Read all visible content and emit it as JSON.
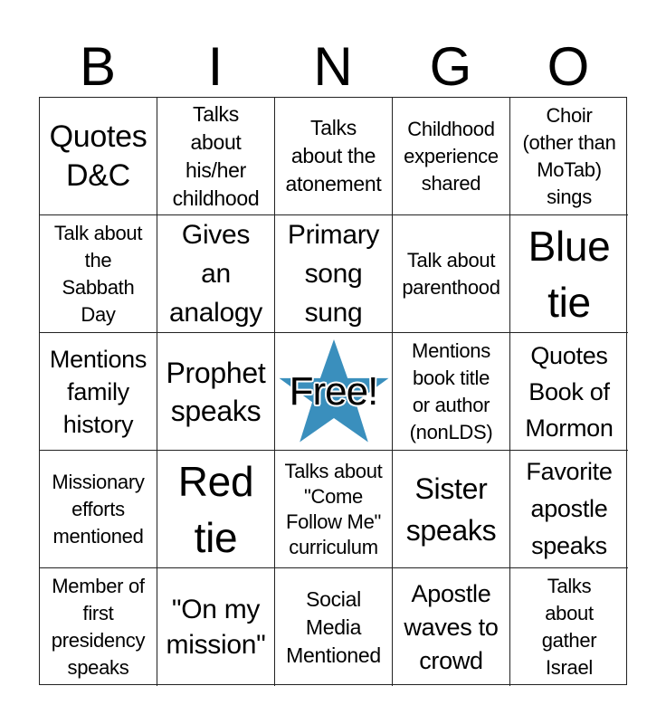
{
  "header": {
    "letters": [
      "B",
      "I",
      "N",
      "G",
      "O"
    ]
  },
  "colors": {
    "free_star": "#3a8fbd",
    "grid_line": "#222222"
  },
  "cells": [
    [
      "Quotes\nD&C",
      "Talks\nabout\nhis/her\nchildhood",
      "Talks\nabout the\natonement",
      "Childhood\nexperience\nshared",
      "Choir\n(other than\nMoTab)\nsings"
    ],
    [
      "Talk about\nthe\nSabbath\nDay",
      "Gives\nan\nanalogy",
      "Primary\nsong\nsung",
      "Talk about\nparenthood",
      "Blue\ntie"
    ],
    [
      "Mentions\nfamily\nhistory",
      "Prophet\nspeaks",
      "Free!",
      "Mentions\nbook title\nor author\n(nonLDS)",
      "Quotes\nBook of\nMormon"
    ],
    [
      "Missionary\nefforts\nmentioned",
      "Red\ntie",
      "Talks about\n\"Come\nFollow Me\"\ncurriculum",
      "Sister\nspeaks",
      "Favorite\napostle\nspeaks"
    ],
    [
      "Member of\nfirst\npresidency\nspeaks",
      "\"On my\nmission\"",
      "Social\nMedia\nMentioned",
      "Apostle\nwaves to\ncrowd",
      "Talks\nabout\ngather\nIsrael"
    ]
  ],
  "free_space": {
    "label": "Free!",
    "icon": "star-icon"
  }
}
